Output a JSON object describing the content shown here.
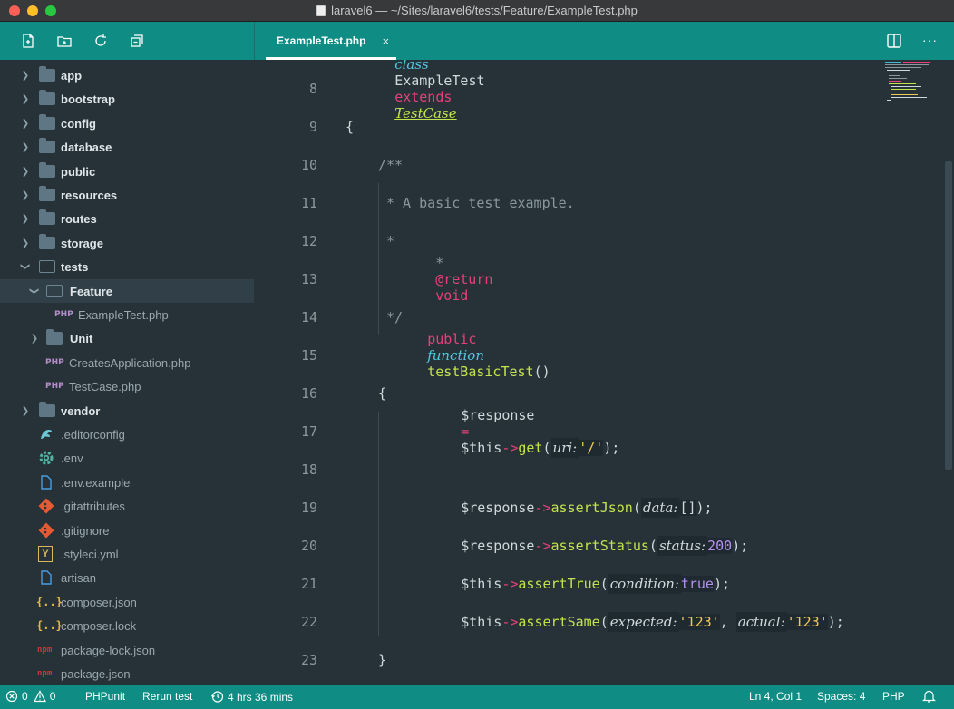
{
  "window": {
    "title": "laravel6 — ~/Sites/laravel6/tests/Feature/ExampleTest.php"
  },
  "toolbar": {
    "icons": [
      "new-file-icon",
      "new-folder-icon",
      "refresh-icon",
      "collapse-all-icon"
    ]
  },
  "tree": {
    "items": [
      {
        "label": "app",
        "type": "folder"
      },
      {
        "label": "bootstrap",
        "type": "folder"
      },
      {
        "label": "config",
        "type": "folder"
      },
      {
        "label": "database",
        "type": "folder"
      },
      {
        "label": "public",
        "type": "folder"
      },
      {
        "label": "resources",
        "type": "folder"
      },
      {
        "label": "routes",
        "type": "folder"
      },
      {
        "label": "storage",
        "type": "folder"
      },
      {
        "label": "tests",
        "type": "folder-open"
      },
      {
        "label": "Feature",
        "type": "folder-open"
      },
      {
        "label": "ExampleTest.php",
        "type": "php",
        "badge": "PHP"
      },
      {
        "label": "Unit",
        "type": "folder"
      },
      {
        "label": "CreatesApplication.php",
        "type": "php",
        "badge": "PHP"
      },
      {
        "label": "TestCase.php",
        "type": "php",
        "badge": "PHP"
      },
      {
        "label": "vendor",
        "type": "folder"
      },
      {
        "label": ".editorconfig",
        "type": "file"
      },
      {
        "label": ".env",
        "type": "file"
      },
      {
        "label": ".env.example",
        "type": "file"
      },
      {
        "label": ".gitattributes",
        "type": "file"
      },
      {
        "label": ".gitignore",
        "type": "file"
      },
      {
        "label": ".styleci.yml",
        "type": "file",
        "badge": "Y"
      },
      {
        "label": "artisan",
        "type": "file"
      },
      {
        "label": "composer.json",
        "type": "file",
        "badge": "{..}"
      },
      {
        "label": "composer.lock",
        "type": "file",
        "badge": "{..}"
      },
      {
        "label": "package-lock.json",
        "type": "file",
        "badge": "npm"
      },
      {
        "label": "package.json",
        "type": "file",
        "badge": "npm"
      }
    ]
  },
  "tab": {
    "label": "ExampleTest.php",
    "close": "×"
  },
  "tab_actions": {
    "split": "split-editor-icon",
    "more": "···"
  },
  "editor": {
    "lines": [
      {
        "n": "8"
      },
      {
        "n": "9"
      },
      {
        "n": "10"
      },
      {
        "n": "11"
      },
      {
        "n": "12"
      },
      {
        "n": "13"
      },
      {
        "n": "14"
      },
      {
        "n": "15"
      },
      {
        "n": "16"
      },
      {
        "n": "17"
      },
      {
        "n": "18"
      },
      {
        "n": "19"
      },
      {
        "n": "20"
      },
      {
        "n": "21"
      },
      {
        "n": "22"
      },
      {
        "n": "23"
      }
    ],
    "tokens": {
      "class_kw": "class",
      "class_name": "ExampleTest",
      "extends_kw": "extends",
      "parent": "TestCase",
      "brace_open": "{",
      "doc_open": "/**",
      "doc_line1": "* A basic test example.",
      "doc_star": "*",
      "doc_ret_star": "*",
      "doc_return": "@return",
      "doc_void": "void",
      "doc_close": "*/",
      "public_kw": "public",
      "function_kw": "function",
      "method_name": "testBasicTest",
      "parens": "()",
      "response_var": "$response",
      "eq": "=",
      "this_var": "$this",
      "arrow": "->",
      "get_fn": "get",
      "uri_hint": "uri:",
      "uri_val": "'/'",
      "assertJson_fn": "assertJson",
      "data_hint": "data:",
      "data_val": "[]",
      "assertStatus_fn": "assertStatus",
      "status_hint": "status:",
      "status_val": "200",
      "assertTrue_fn": "assertTrue",
      "condition_hint": "condition:",
      "condition_val": "true",
      "assertSame_fn": "assertSame",
      "expected_hint": "expected:",
      "expected_val": "'123'",
      "actual_hint": "actual:",
      "actual_val": "'123'",
      "brace_close": "}"
    }
  },
  "status": {
    "errors": "0",
    "warnings": "0",
    "phpunit": "PHPunit",
    "rerun": "Rerun test",
    "time": "4 hrs 36 mins",
    "position": "Ln 4, Col 1",
    "spaces": "Spaces: 4",
    "language": "PHP"
  },
  "colors": {
    "accent": "#0f8c84",
    "editor_bg": "#263238"
  }
}
